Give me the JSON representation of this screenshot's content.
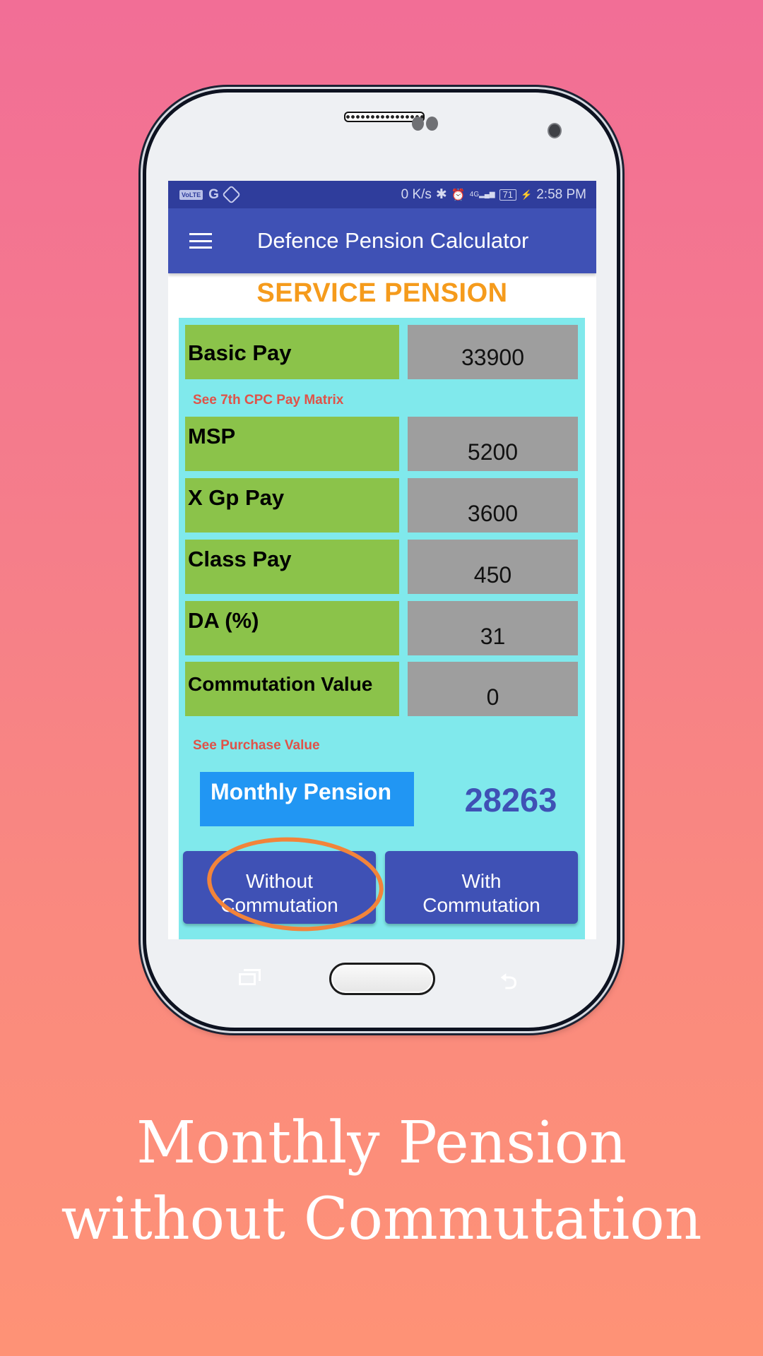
{
  "status_bar": {
    "left_icons": [
      "volte-icon",
      "google-g-icon",
      "shield-icon"
    ],
    "volte_label": "VoLTE",
    "g_label": "G",
    "network_speed": "0 K/s",
    "bluetooth_glyph": "✱",
    "alarm_glyph": "⏰",
    "signal_label": "4G",
    "battery_level": "71",
    "charging_glyph": "⚡",
    "time": "2:58 PM"
  },
  "app_bar": {
    "menu_icon": "hamburger-menu-icon",
    "title": "Defence Pension Calculator"
  },
  "section_title": "SERVICE PENSION",
  "fields": [
    {
      "label": "Basic Pay",
      "value": "33900"
    },
    {
      "label": "MSP",
      "value": "5200"
    },
    {
      "label": "X Gp Pay",
      "value": "3600"
    },
    {
      "label": "Class Pay",
      "value": "450"
    },
    {
      "label": "DA (%)",
      "value": "31"
    },
    {
      "label": "Commutation Value",
      "value": "0"
    }
  ],
  "links": {
    "pay_matrix": "See 7th CPC Pay Matrix",
    "purchase_value": "See Purchase Value"
  },
  "result": {
    "label": "Monthly Pension",
    "value": "28263"
  },
  "buttons": {
    "without_commutation": [
      "Without",
      "Commutation"
    ],
    "with_commutation": [
      "With",
      "Commutation"
    ]
  },
  "nav_keys": {
    "recent": "recent-apps-icon",
    "home": "home-button",
    "back_glyph": "⮌"
  },
  "caption": [
    "Monthly Pension",
    "without Commutation"
  ],
  "colors": {
    "status_bar": "#2F3D9C",
    "app_bar": "#3F51B5",
    "section_title": "#F59B1C",
    "panel": "#80E9EC",
    "label_bg": "#8BC34A",
    "value_bg": "#9E9E9E",
    "link": "#E05248",
    "result_box": "#2196F3",
    "highlight": "#F2843A"
  }
}
